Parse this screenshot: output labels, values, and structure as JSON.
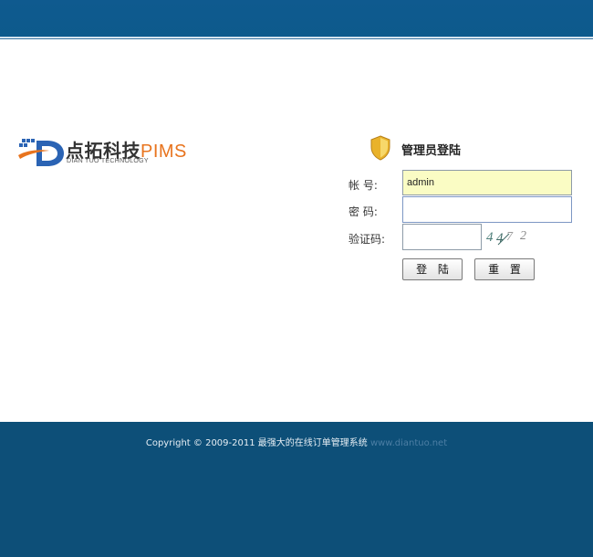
{
  "logo": {
    "brand_cn": "点拓科技",
    "brand_en": "PIMS",
    "subtitle": "DIAN TUO TECHNOLOGY"
  },
  "login": {
    "title": "管理员登陆",
    "account_label": "帐 号:",
    "password_label": "密 码:",
    "captcha_label": "验证码:",
    "account_value": "admin",
    "password_value": "",
    "captcha_value": "",
    "captcha_text": "4472",
    "login_button": "登 陆",
    "reset_button": "重 置"
  },
  "footer": {
    "copyright": "Copyright © 2009-2011 最强大的在线订单管理系统",
    "site": "www.diantuo.net"
  },
  "colors": {
    "header": "#0d5a8c",
    "footer": "#0d4f78",
    "brand_orange": "#e8741e",
    "brand_blue": "#2a63b4",
    "account_bg": "#fafcc4"
  },
  "icons": {
    "logo": "dt-logo-icon",
    "shield": "shield-icon"
  }
}
